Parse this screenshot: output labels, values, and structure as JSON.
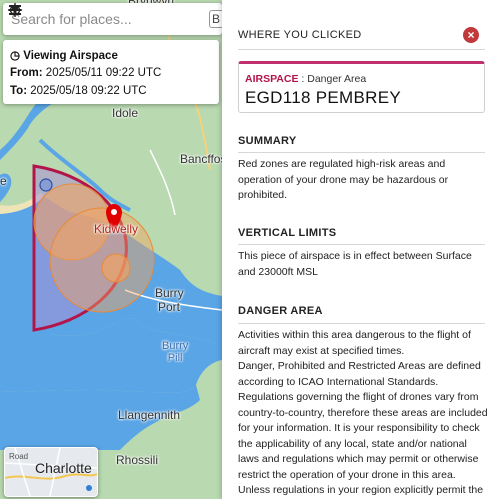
{
  "search": {
    "placeholder": "Search for places...",
    "extra_icon": "B"
  },
  "info_card": {
    "title": "Viewing Airspace",
    "from_label": "From:",
    "from_value": "2025/05/11 09:22 UTC",
    "to_label": "To:",
    "to_value": "2025/05/18 09:22 UTC"
  },
  "map": {
    "places": {
      "brynwyn": "Brynwyn",
      "idole": "Idole",
      "bancffos": "Bancffos",
      "kidwelly": "Kidwelly",
      "burry_port_1": "Burry",
      "burry_port_2": "Port",
      "burry_pill_1": "Burry",
      "burry_pill_2": "Pill",
      "llangennith": "Llangennith",
      "rhossili": "Rhossili",
      "edge_e": "e"
    },
    "colors": {
      "zone_border": "#b3154a",
      "zone_fill": "#a98fd6",
      "sea": "#5aa5e6",
      "land": "#b9d9b0"
    }
  },
  "basemap_switch": {
    "tag": "Road",
    "city": "Charlotte"
  },
  "panel": {
    "where_you_clicked": "WHERE YOU CLICKED",
    "airspace_type_label": "AIRSPACE",
    "airspace_type_value": " : Danger Area",
    "airspace_name": "EGD118 PEMBREY",
    "summary_heading": "SUMMARY",
    "summary_text": "Red zones are regulated high-risk areas and operation of your drone may be hazardous or prohibited.",
    "vertical_heading": "VERTICAL LIMITS",
    "vertical_text": "This piece of airspace is in effect between Surface and 23000ft MSL",
    "danger_heading": "DANGER AREA",
    "danger_text_1": "Activities within this area dangerous to the flight of aircraft may exist at specified times.",
    "danger_text_2": "Danger, Prohibited and Restricted Areas are defined according to ICAO International Standards. Regulations governing the flight of drones vary from country-to-country, therefore these areas are included for your information. It is your responsibility to check the applicability of any local, state and/or national laws and regulations which may permit or otherwise restrict the operation of your drone in this area. Unless regulations in your region explicitly permit the operation of your drone"
  }
}
